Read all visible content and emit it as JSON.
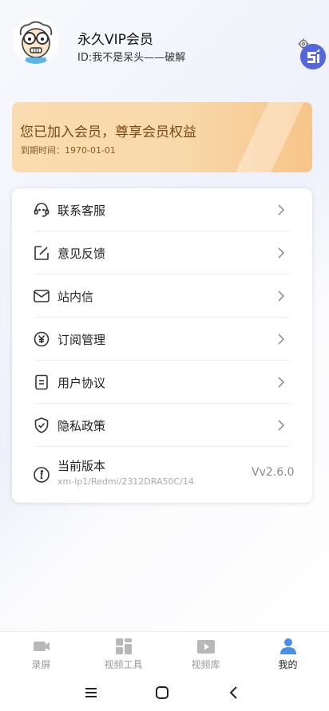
{
  "profile": {
    "username": "永久VIP会员",
    "id_text": "ID:我不是呆头——破解"
  },
  "vip": {
    "title": "您已加入会员，尊享会员权益",
    "expire": "到期时间：1970-01-01"
  },
  "menu": {
    "items": [
      {
        "label": "联系客服",
        "icon": "headset-icon"
      },
      {
        "label": "意见反馈",
        "icon": "edit-icon"
      },
      {
        "label": "站内信",
        "icon": "mail-icon"
      },
      {
        "label": "订阅管理",
        "icon": "yen-icon"
      },
      {
        "label": "用户协议",
        "icon": "document-icon"
      },
      {
        "label": "隐私政策",
        "icon": "shield-icon"
      }
    ],
    "version": {
      "label": "当前版本",
      "device": "xm-lp1/Redmi/2312DRA50C/14",
      "value": "Vv2.6.0",
      "icon": "info-icon"
    }
  },
  "tabs": [
    {
      "label": "录屏",
      "icon": "record-icon"
    },
    {
      "label": "视频工具",
      "icon": "grid-icon"
    },
    {
      "label": "视频库",
      "icon": "video-library-icon"
    },
    {
      "label": "我的",
      "icon": "person-icon",
      "active": true
    }
  ],
  "colors": {
    "accent": "#4a8fe7",
    "vip_text": "#7a4a16"
  }
}
